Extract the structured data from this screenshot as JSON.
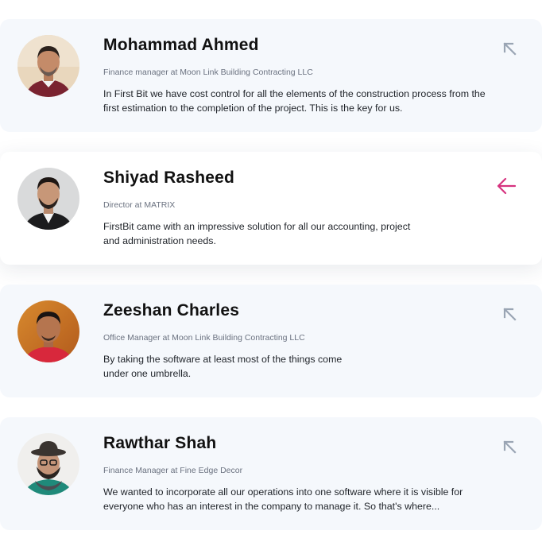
{
  "colors": {
    "card_bg": "#f5f8fc",
    "active_card_bg": "#ffffff",
    "name_text": "#111111",
    "role_text": "#6b7280",
    "quote_text": "#1f2329",
    "inactive_arrow": "#9aa5b4",
    "active_arrow": "#d6337f"
  },
  "testimonials": [
    {
      "name": "Mohammad Ahmed",
      "role": "Finance manager at Moon Link Building Contracting LLC",
      "quote": "In First Bit we have cost control for all the elements of the construction process from the first estimation to the completion of the project. This is the key for us.",
      "active": false,
      "icon": "arrow-up-left-icon"
    },
    {
      "name": "Shiyad Rasheed",
      "role": "Director at MATRIX",
      "quote": "FirstBit came with an impressive solution for all our accounting, project and administration needs.",
      "active": true,
      "icon": "arrow-left-icon"
    },
    {
      "name": "Zeeshan Charles",
      "role": "Office Manager at Moon Link Building Contracting LLC",
      "quote": "By taking the software at least most of the things come under one umbrella.",
      "active": false,
      "icon": "arrow-up-left-icon"
    },
    {
      "name": "Rawthar Shah",
      "role": "Finance Manager at Fine Edge Decor",
      "quote": "We wanted to incorporate all our operations into one software where it is visible for everyone who has an interest in the company to manage it. So that's where...",
      "active": false,
      "icon": "arrow-up-left-icon"
    }
  ]
}
